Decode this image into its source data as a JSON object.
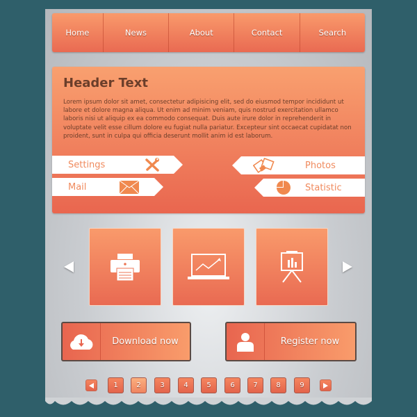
{
  "nav": {
    "items": [
      {
        "label": "Home"
      },
      {
        "label": "News"
      },
      {
        "label": "About"
      },
      {
        "label": "Contact"
      },
      {
        "label": "Search"
      }
    ]
  },
  "hero": {
    "title": "Header Text",
    "body": "Lorem ipsum dolor sit amet, consectetur adipisicing elit, sed do eiusmod tempor incididunt ut labore et dolore magna aliqua. Ut enim ad minim veniam, quis nostrud exercitation ullamco laboris nisi ut aliquip ex ea commodo consequat. Duis aute irure dolor in reprehenderit in voluptate velit esse cillum dolore eu fugiat nulla pariatur. Excepteur sint occaecat cupidatat non proident, sunt in culpa qui officia deserunt mollit anim id est laborum."
  },
  "tags": {
    "settings": {
      "label": "Settings",
      "icon": "wrench-screwdriver-icon"
    },
    "mail": {
      "label": "Mail",
      "icon": "envelope-icon"
    },
    "photos": {
      "label": "Photos",
      "icon": "photos-icon"
    },
    "statistic": {
      "label": "Statistic",
      "icon": "pie-chart-icon"
    }
  },
  "tiles": [
    {
      "icon": "printer-icon"
    },
    {
      "icon": "laptop-chart-icon"
    },
    {
      "icon": "presentation-board-icon"
    }
  ],
  "buttons": {
    "download": {
      "label": "Download now",
      "icon": "cloud-download-icon"
    },
    "register": {
      "label": "Register now",
      "icon": "user-icon"
    }
  },
  "pagination": {
    "pages": [
      "1",
      "2",
      "3",
      "4",
      "5",
      "6",
      "7",
      "8",
      "9"
    ],
    "current": "2"
  },
  "colors": {
    "accent": "#ef7a58",
    "background": "#2f5f6a",
    "text_dark": "#6b3e2a"
  }
}
